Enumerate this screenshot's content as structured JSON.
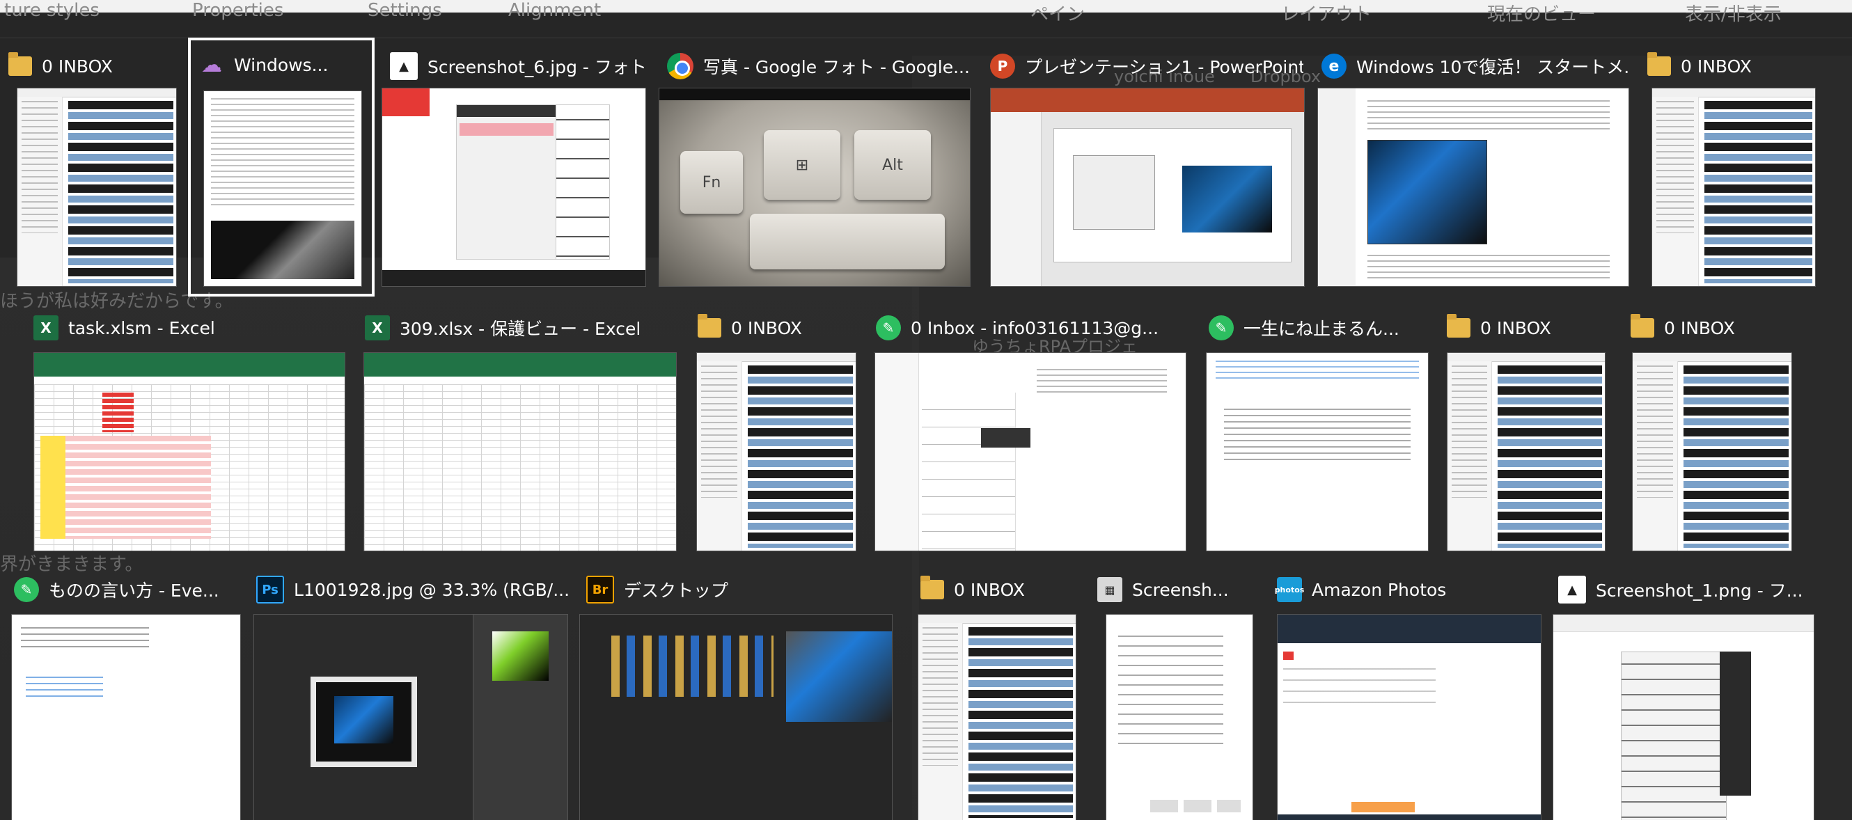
{
  "background": {
    "top_tabs": [
      "ture styles",
      "Properties",
      "Settings",
      "Alignment",
      "ペイン",
      "レイアウト",
      "現在のビュー",
      "表示/非表示"
    ],
    "fragments": [
      "ほうが私は好みだからです。",
      "ゆうちょRPAプロジェ",
      "界がきまきます。",
      "yoichi inoue",
      "Dropbox"
    ]
  },
  "windows": [
    {
      "id": "w1",
      "title": "0 INBOX",
      "icon": "folder-icon",
      "thumb": "explorer",
      "selected": false
    },
    {
      "id": "w2",
      "title": "Windows...",
      "icon": "cloud-icon",
      "thumb": "doc",
      "selected": true
    },
    {
      "id": "w3",
      "title": "Screenshot_6.jpg - フォト",
      "icon": "photos-icon",
      "thumb": "menu",
      "selected": false
    },
    {
      "id": "w4",
      "title": "写真 - Google フォト - Google...",
      "icon": "chrome-icon",
      "thumb": "keyboard",
      "selected": false
    },
    {
      "id": "w5",
      "title": "プレゼンテーション1 - PowerPoint",
      "icon": "powerpoint-icon",
      "thumb": "ppt",
      "selected": false
    },
    {
      "id": "w6",
      "title": "Windows 10で復活！ スタートメ...",
      "icon": "edge-icon",
      "thumb": "edge",
      "selected": false
    },
    {
      "id": "w7",
      "title": "0 INBOX",
      "icon": "folder-icon",
      "thumb": "explorer",
      "selected": false
    },
    {
      "id": "w8",
      "title": "task.xlsm - Excel",
      "icon": "excel-icon",
      "thumb": "excel",
      "selected": false
    },
    {
      "id": "w9",
      "title": "309.xlsx  -  保護ビュー - Excel",
      "icon": "excel-icon",
      "thumb": "excel2",
      "selected": false
    },
    {
      "id": "w10",
      "title": "0 INBOX",
      "icon": "folder-icon",
      "thumb": "explorer",
      "selected": false
    },
    {
      "id": "w11",
      "title": "0    Inbox - info03161113@g...",
      "icon": "evernote-icon",
      "thumb": "evernote",
      "selected": false
    },
    {
      "id": "w12",
      "title": "一生にね止まるん...",
      "icon": "evernote-icon",
      "thumb": "note",
      "selected": false
    },
    {
      "id": "w13",
      "title": "0 INBOX",
      "icon": "folder-icon",
      "thumb": "explorer",
      "selected": false
    },
    {
      "id": "w14",
      "title": "0 INBOX",
      "icon": "folder-icon",
      "thumb": "explorer",
      "selected": false
    },
    {
      "id": "w15",
      "title": "ものの言い方 - Eve...",
      "icon": "evernote-icon",
      "thumb": "evernote2",
      "selected": false
    },
    {
      "id": "w16",
      "title": "L1001928.jpg @ 33.3% (RGB/...",
      "icon": "photoshop-icon",
      "thumb": "ps",
      "selected": false
    },
    {
      "id": "w17",
      "title": "デスクトップ",
      "icon": "bridge-icon",
      "thumb": "bridge",
      "selected": false
    },
    {
      "id": "w18",
      "title": "0 INBOX",
      "icon": "folder-icon",
      "thumb": "explorer",
      "selected": false
    },
    {
      "id": "w19",
      "title": "Screensh...",
      "icon": "screenshot-icon",
      "thumb": "props",
      "selected": false
    },
    {
      "id": "w20",
      "title": "Amazon Photos",
      "icon": "amazon-photos-icon",
      "thumb": "amazon",
      "selected": false
    },
    {
      "id": "w21",
      "title": "Screenshot_1.png - フ...",
      "icon": "photos-icon",
      "thumb": "startmenu",
      "selected": false
    }
  ],
  "keyboard_keys": [
    "Fn",
    "Alt"
  ],
  "icon_glyphs": {
    "powerpoint-icon": "P",
    "excel-icon": "X",
    "photoshop-icon": "Ps",
    "bridge-icon": "Br",
    "evernote-icon": "✎",
    "edge-icon": "e",
    "cloud-icon": "☁",
    "amazon-photos-icon": "photos",
    "screenshot-icon": "▦"
  },
  "colors": {
    "overlay": "#262626",
    "selection": "#ffffff",
    "title_text": "#ffffff"
  }
}
